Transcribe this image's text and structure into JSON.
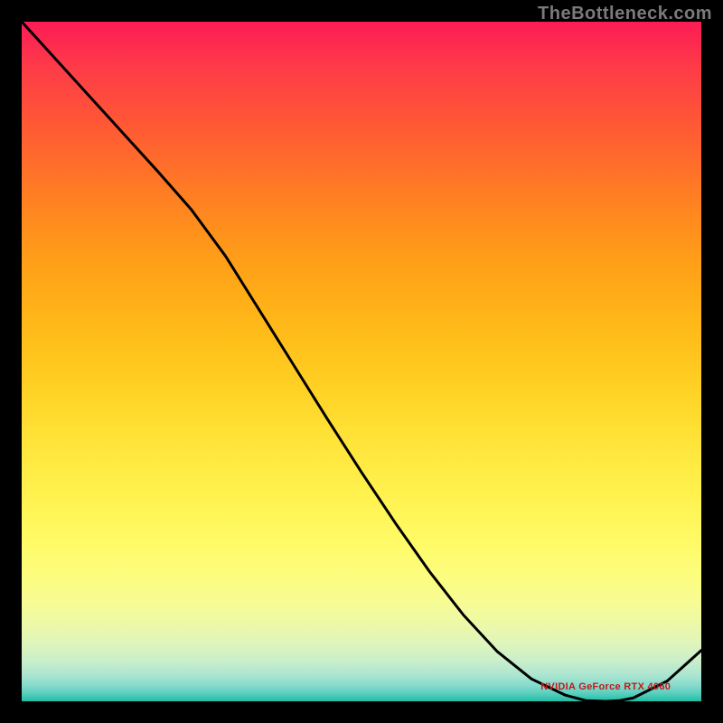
{
  "attribution": "TheBottleneck.com",
  "point_label": "NVIDIA GeForce RTX 4060",
  "chart_data": {
    "type": "line",
    "x": [
      0.0,
      0.05,
      0.1,
      0.15,
      0.2,
      0.25,
      0.3,
      0.35,
      0.4,
      0.45,
      0.5,
      0.55,
      0.6,
      0.65,
      0.7,
      0.75,
      0.8,
      0.83,
      0.86,
      0.88,
      0.9,
      0.95,
      1.0
    ],
    "values": [
      1.0,
      0.945,
      0.89,
      0.835,
      0.78,
      0.723,
      0.655,
      0.575,
      0.495,
      0.415,
      0.337,
      0.262,
      0.191,
      0.127,
      0.073,
      0.033,
      0.009,
      0.001,
      0.0,
      0.001,
      0.005,
      0.03,
      0.075
    ],
    "title": "",
    "xlabel": "",
    "ylabel": "",
    "xlim": [
      0,
      1
    ],
    "ylim": [
      0,
      1
    ],
    "grid": false,
    "annotations": [
      {
        "text": "NVIDIA GeForce RTX 4060",
        "x": 0.85,
        "y": 0.01
      }
    ],
    "style": {
      "background": "heatmap-gradient-vertical",
      "line_color": "#000000",
      "line_width": 2
    }
  }
}
